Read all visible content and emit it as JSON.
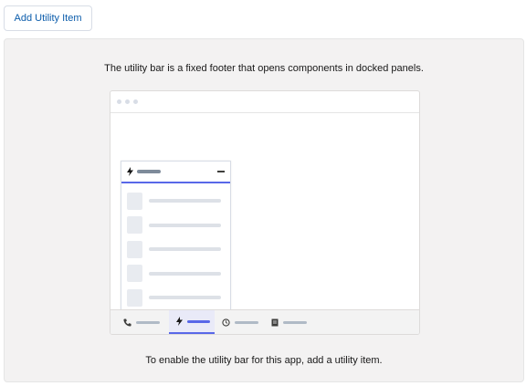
{
  "toolbar": {
    "add_button_label": "Add Utility Item"
  },
  "empty_state": {
    "description": "The utility bar is a fixed footer that opens components in docked panels.",
    "instruction": "To enable the utility bar for this app, add a utility item."
  },
  "illustration": {
    "docked_panel": {
      "header_icon": "lightning-icon",
      "action_icon": "minimize-icon",
      "row_count": 5
    },
    "utility_bar_items": [
      {
        "icon": "phone-icon",
        "active": false
      },
      {
        "icon": "lightning-icon",
        "active": true
      },
      {
        "icon": "clock-icon",
        "active": false
      },
      {
        "icon": "note-icon",
        "active": false
      }
    ],
    "colors": {
      "accent": "#5867e8",
      "link": "#0b5cab",
      "panel_background": "#f3f2f2"
    }
  }
}
